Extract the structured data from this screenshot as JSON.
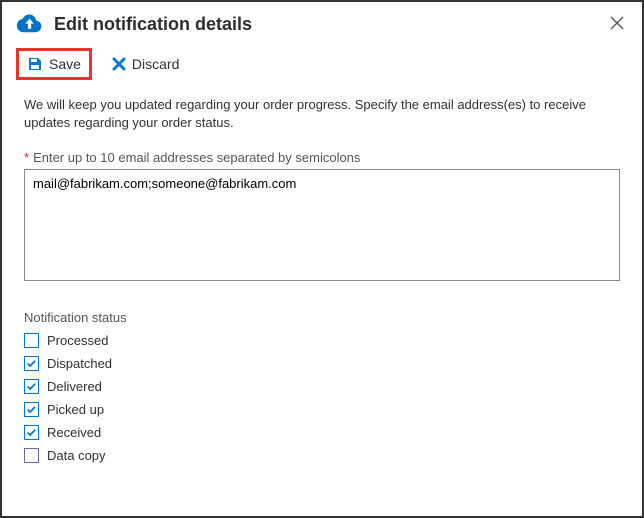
{
  "header": {
    "title": "Edit notification details"
  },
  "toolbar": {
    "save_label": "Save",
    "discard_label": "Discard"
  },
  "content": {
    "description": "We will keep you updated regarding your order progress. Specify the email address(es) to receive updates regarding your order status.",
    "email_field_label": "Enter up to 10 email addresses separated by semicolons",
    "email_value": "mail@fabrikam.com;someone@fabrikam.com",
    "status_section_label": "Notification status",
    "statuses": [
      {
        "label": "Processed",
        "checked": false,
        "variant": "blue"
      },
      {
        "label": "Dispatched",
        "checked": true,
        "variant": "blue"
      },
      {
        "label": "Delivered",
        "checked": true,
        "variant": "blue"
      },
      {
        "label": "Picked up",
        "checked": true,
        "variant": "blue"
      },
      {
        "label": "Received",
        "checked": true,
        "variant": "blue"
      },
      {
        "label": "Data copy",
        "checked": false,
        "variant": "purple"
      }
    ]
  }
}
